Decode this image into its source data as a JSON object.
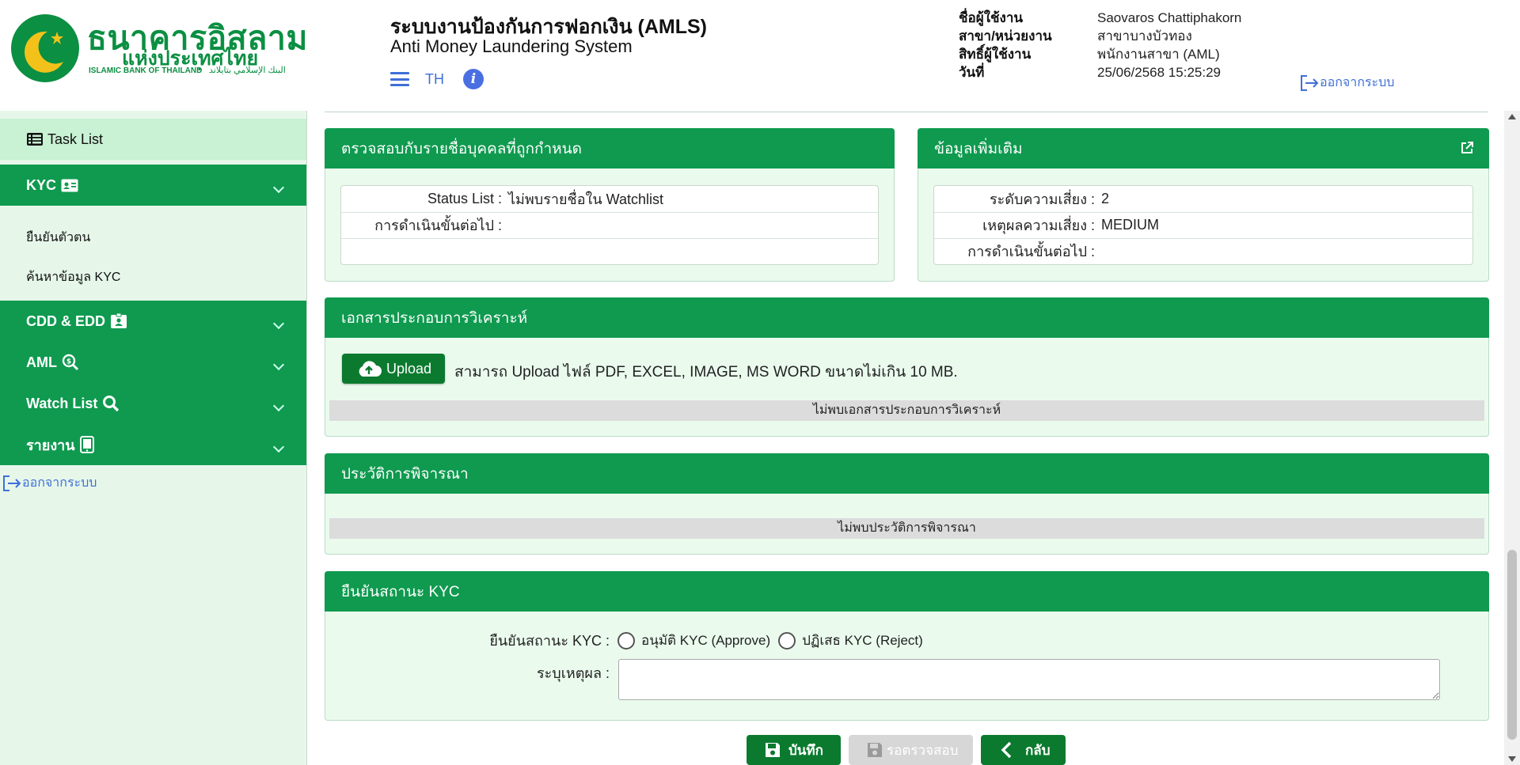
{
  "header": {
    "logo": {
      "name_th": "ธนาคารอิสลาม",
      "name_th2": "แห่งประเทศไทย",
      "name_en": "ISLAMIC BANK OF THAILAND",
      "name_ar": "البنك الإسلامي بتايلاند"
    },
    "title": "ระบบงานป้องกันการฟอกเงิน (AMLS)",
    "subtitle": "Anti Money Laundering System",
    "lang": "TH",
    "user": {
      "name_label": "ชื่อผู้ใช้งาน",
      "name_value": "Saovaros Chattiphakorn",
      "branch_label": "สาขา/หน่วยงาน",
      "branch_value": "สาขาบางบัวทอง",
      "role_label": "สิทธิ์ผู้ใช้งาน",
      "role_value": "พนักงานสาขา (AML)",
      "date_label": "วันที่",
      "date_value": "25/06/2568 15:25:29"
    },
    "logout": "ออกจากระบบ"
  },
  "sidebar": {
    "task_list": "Task List",
    "kyc": "KYC",
    "kyc_items": [
      "ยืนยันตัวตน",
      "ค้นหาข้อมูล KYC"
    ],
    "cdd_edd": "CDD & EDD",
    "aml": "AML",
    "watch_list": "Watch List",
    "report": "รายงาน",
    "logout": "ออกจากระบบ"
  },
  "watchlist_panel": {
    "title": "ตรวจสอบกับรายชื่อบุคคลที่ถูกกำหนด",
    "rows": [
      {
        "label": "Status List :",
        "value": "ไม่พบรายชื่อใน Watchlist"
      },
      {
        "label": "การดำเนินขั้นต่อไป :",
        "value": ""
      },
      {
        "label": "",
        "value": ""
      }
    ]
  },
  "extra_panel": {
    "title": "ข้อมูลเพิ่มเติม",
    "rows": [
      {
        "label": "ระดับความเสี่ยง :",
        "value": "2"
      },
      {
        "label": "เหตุผลความเสี่ยง :",
        "value": "MEDIUM"
      },
      {
        "label": "การดำเนินขั้นต่อไป :",
        "value": ""
      }
    ]
  },
  "documents_panel": {
    "title": "เอกสารประกอบการวิเคราะห์",
    "upload_label": "Upload",
    "hint": "สามารถ Upload ไฟล์ PDF, EXCEL, IMAGE, MS WORD ขนาดไม่เกิน 10 MB.",
    "empty": "ไม่พบเอกสารประกอบการวิเคราะห์"
  },
  "history_panel": {
    "title": "ประวัติการพิจารณา",
    "empty": "ไม่พบประวัติการพิจารณา"
  },
  "confirm_panel": {
    "title": "ยืนยันสถานะ KYC",
    "status_label": "ยืนยันสถานะ KYC :",
    "approve": "อนุมัติ KYC (Approve)",
    "reject": "ปฏิเสธ KYC (Reject)",
    "reason_label": "ระบุเหตุผล :",
    "reason_value": ""
  },
  "actions": {
    "save": "บันทึก",
    "check": "รอตรวจสอบ",
    "back": "กลับ"
  },
  "colors": {
    "primary_green": "#0f9a4f",
    "dark_green": "#0b7a2f",
    "panel_bg": "#eafbee",
    "sidebar_bg": "#e6f7ea",
    "link_blue": "#3f6fd8"
  }
}
